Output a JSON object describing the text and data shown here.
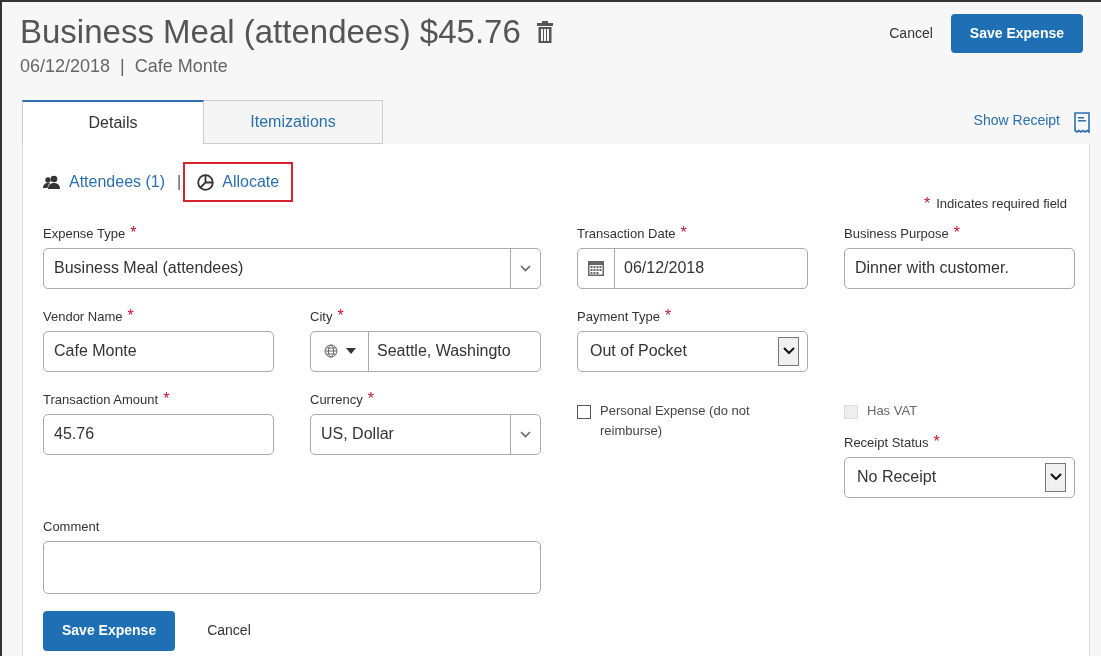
{
  "header": {
    "title": "Business Meal (attendees) $45.76",
    "date": "06/12/2018",
    "separator": "|",
    "vendor": "Cafe Monte",
    "cancel": "Cancel",
    "save": "Save Expense"
  },
  "tabs": [
    {
      "label": "Details",
      "selected": true
    },
    {
      "label": "Itemizations",
      "selected": false
    }
  ],
  "show_receipt": "Show Receipt",
  "links": [
    {
      "kind": "attendees",
      "label": "Attendees (1)",
      "highlighted": false
    },
    {
      "kind": "allocate",
      "label": "Allocate",
      "highlighted": true
    }
  ],
  "links_separator": "|",
  "required_note": {
    "mark": "*",
    "text": "Indicates required field"
  },
  "fields": [
    {
      "kind": "select",
      "label": "Expense Type",
      "required": true,
      "value": "Business Meal (attendees)"
    },
    {
      "kind": "date",
      "label": "Transaction Date",
      "required": true,
      "value": "06/12/2018"
    },
    {
      "kind": "text",
      "label": "Business Purpose",
      "required": true,
      "value": "Dinner with customer."
    },
    {
      "kind": "text",
      "label": "Vendor Name",
      "required": true,
      "value": "Cafe Monte"
    },
    {
      "kind": "city",
      "label": "City",
      "required": true,
      "value": "Seattle, Washingto"
    },
    {
      "kind": "dropdown",
      "label": "Payment Type",
      "required": true,
      "value": "Out of Pocket"
    },
    {
      "kind": "text",
      "label": "Transaction Amount",
      "required": true,
      "value": "45.76"
    },
    {
      "kind": "select",
      "label": "Currency",
      "required": true,
      "value": "US, Dollar"
    },
    {
      "kind": "checkbox",
      "label": "Personal Expense (do not reimburse)",
      "checked": false,
      "disabled": false
    },
    {
      "kind": "checkbox",
      "label": "Has VAT",
      "checked": false,
      "disabled": true
    },
    {
      "kind": "dropdown",
      "label": "Receipt Status",
      "required": true,
      "value": "No Receipt"
    },
    {
      "kind": "textarea",
      "label": "Comment",
      "required": false
    }
  ],
  "footer": {
    "save": "Save Expense",
    "cancel": "Cancel"
  }
}
